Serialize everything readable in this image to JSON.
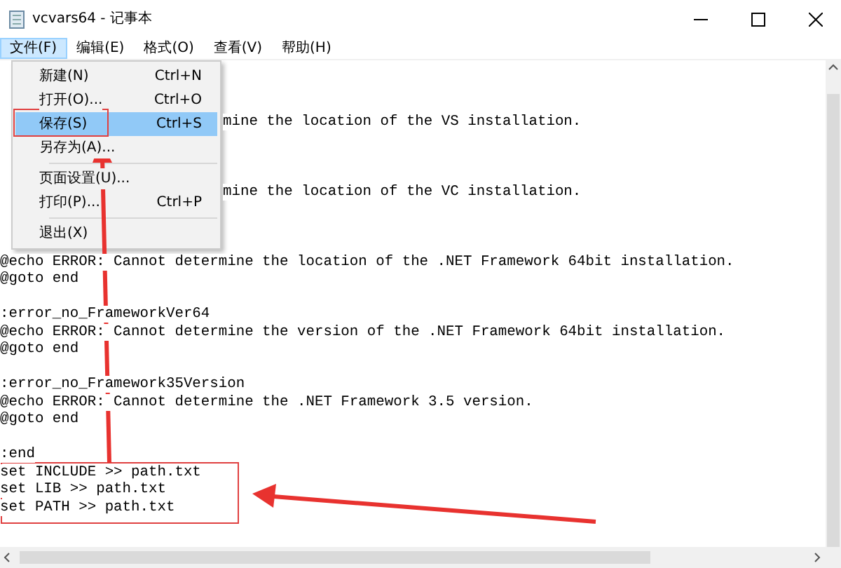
{
  "window": {
    "title": "vcvars64 - 记事本"
  },
  "menu_bar": [
    {
      "label": "文件(F)",
      "selected": true
    },
    {
      "label": "编辑(E)",
      "selected": false
    },
    {
      "label": "格式(O)",
      "selected": false
    },
    {
      "label": "查看(V)",
      "selected": false
    },
    {
      "label": "帮助(H)",
      "selected": false
    }
  ],
  "file_menu": [
    {
      "kind": "item",
      "label": "新建(N)",
      "shortcut": "Ctrl+N",
      "selected": false
    },
    {
      "kind": "item",
      "label": "打开(O)...",
      "shortcut": "Ctrl+O",
      "selected": false
    },
    {
      "kind": "item",
      "label": "保存(S)",
      "shortcut": "Ctrl+S",
      "selected": true
    },
    {
      "kind": "item",
      "label": "另存为(A)...",
      "selected": false
    },
    {
      "kind": "separator"
    },
    {
      "kind": "item",
      "label": "页面设置(U)...",
      "selected": false
    },
    {
      "kind": "item",
      "label": "打印(P)...",
      "shortcut": "Ctrl+P",
      "selected": false
    },
    {
      "kind": "separator"
    },
    {
      "kind": "item",
      "label": "退出(X)",
      "selected": false
    }
  ],
  "editor_lines": [
    {
      "kind": "blank"
    },
    {
      "kind": "blank"
    },
    {
      "kind": "blank"
    },
    {
      "kind": "partial",
      "text": "mine the location of the VS installation."
    },
    {
      "kind": "blank"
    },
    {
      "kind": "blank"
    },
    {
      "kind": "blank"
    },
    {
      "kind": "partial",
      "text": "mine the location of the VC installation."
    },
    {
      "kind": "blank"
    },
    {
      "kind": "blank"
    },
    {
      "kind": "blank"
    },
    {
      "kind": "text",
      "text": "@echo ERROR: Cannot determine the location of the .NET Framework 64bit installation."
    },
    {
      "kind": "text",
      "text": "@goto end"
    },
    {
      "kind": "blank"
    },
    {
      "kind": "text",
      "text": ":error_no_FrameworkVer64"
    },
    {
      "kind": "text",
      "text": "@echo ERROR: Cannot determine the version of the .NET Framework 64bit installation."
    },
    {
      "kind": "text",
      "text": "@goto end"
    },
    {
      "kind": "blank"
    },
    {
      "kind": "text",
      "text": ":error_no_Framework35Version"
    },
    {
      "kind": "text",
      "text": "@echo ERROR: Cannot determine the .NET Framework 3.5 version."
    },
    {
      "kind": "text",
      "text": "@goto end"
    },
    {
      "kind": "blank"
    },
    {
      "kind": "text",
      "text": ":end"
    },
    {
      "kind": "text",
      "text": "set INCLUDE >> path.txt"
    },
    {
      "kind": "text",
      "text": "set LIB >> path.txt"
    },
    {
      "kind": "text",
      "text": "set PATH >> path.txt"
    }
  ]
}
